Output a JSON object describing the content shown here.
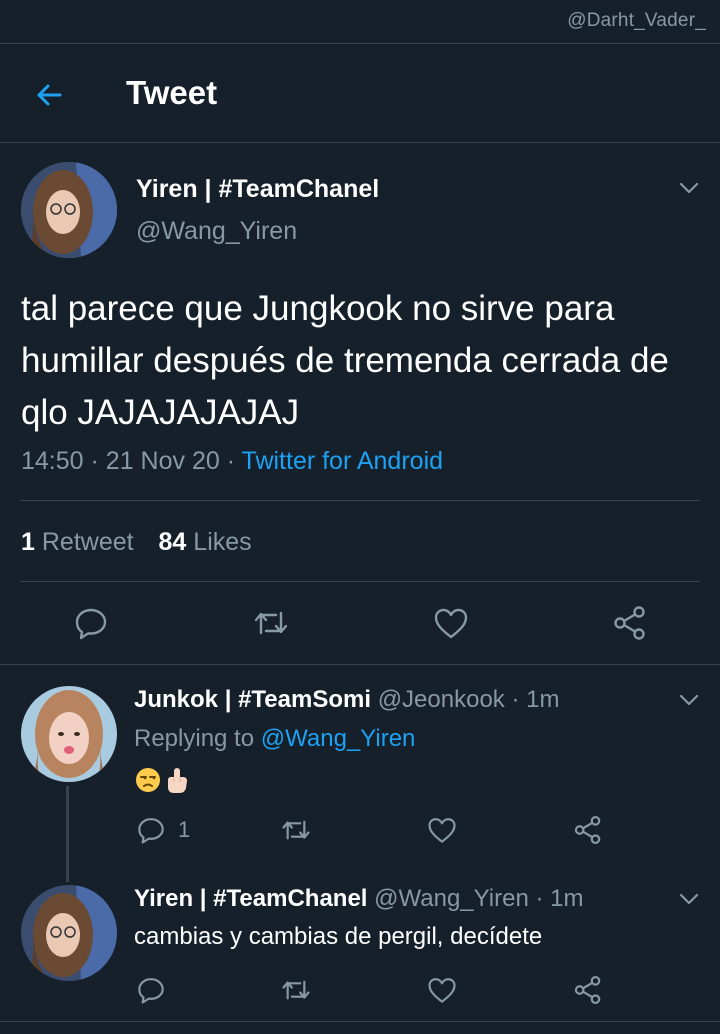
{
  "watermark": "@Darht_Vader_",
  "header": {
    "title": "Tweet"
  },
  "main_tweet": {
    "name": "Yiren | #TeamChanel",
    "handle": "@Wang_Yiren",
    "text": "tal parece que Jungkook no sirve para humillar después de tremenda cerrada de qlo JAJAJAJAJAJ",
    "time": "14:50",
    "date": "21 Nov 20",
    "sep": "·",
    "client": "Twitter for Android",
    "retweets_count": "1",
    "retweets_label": "Retweet",
    "likes_count": "84",
    "likes_label": "Likes"
  },
  "reply_1": {
    "name": "Junkok | #TeamSomi",
    "handle": "@Jeonkook",
    "time": "1m",
    "sep": "·",
    "replying_label": "Replying to",
    "replying_to": "@Wang_Yiren",
    "reply_count": "1",
    "emoji": [
      "unamused-face",
      "middle-finger"
    ]
  },
  "reply_2": {
    "name": "Yiren | #TeamChanel",
    "handle": "@Wang_Yiren",
    "time": "1m",
    "sep": "·",
    "text": "cambias y cambias de pergil, decídete"
  },
  "colors": {
    "background": "#15202b",
    "divider": "#38444d",
    "muted": "#8899a6",
    "accent": "#1da1f2"
  },
  "icons": [
    "back-arrow-icon",
    "chevron-down-icon",
    "reply-icon",
    "retweet-icon",
    "like-icon",
    "share-icon"
  ]
}
